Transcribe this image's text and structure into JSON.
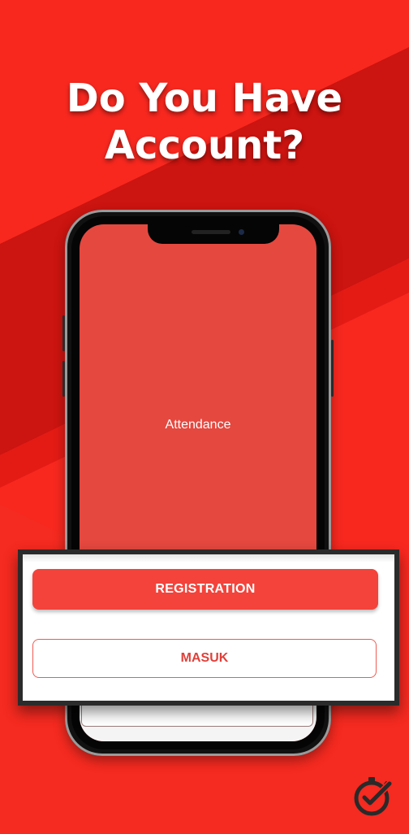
{
  "headline": {
    "line1": "Do You Have",
    "line2": "Account?"
  },
  "app_screen": {
    "title": "Attendance"
  },
  "buttons": {
    "registration": "REGISTRATION",
    "masuk": "MASUK"
  },
  "icons": {
    "logo": "clock-check-logo-icon"
  },
  "colors": {
    "background": "#f8281f",
    "background_dark_band": "#cf1410",
    "screen": "#e5483f",
    "primary_button": "#f3433b",
    "outline_button_border": "#f05a52"
  }
}
